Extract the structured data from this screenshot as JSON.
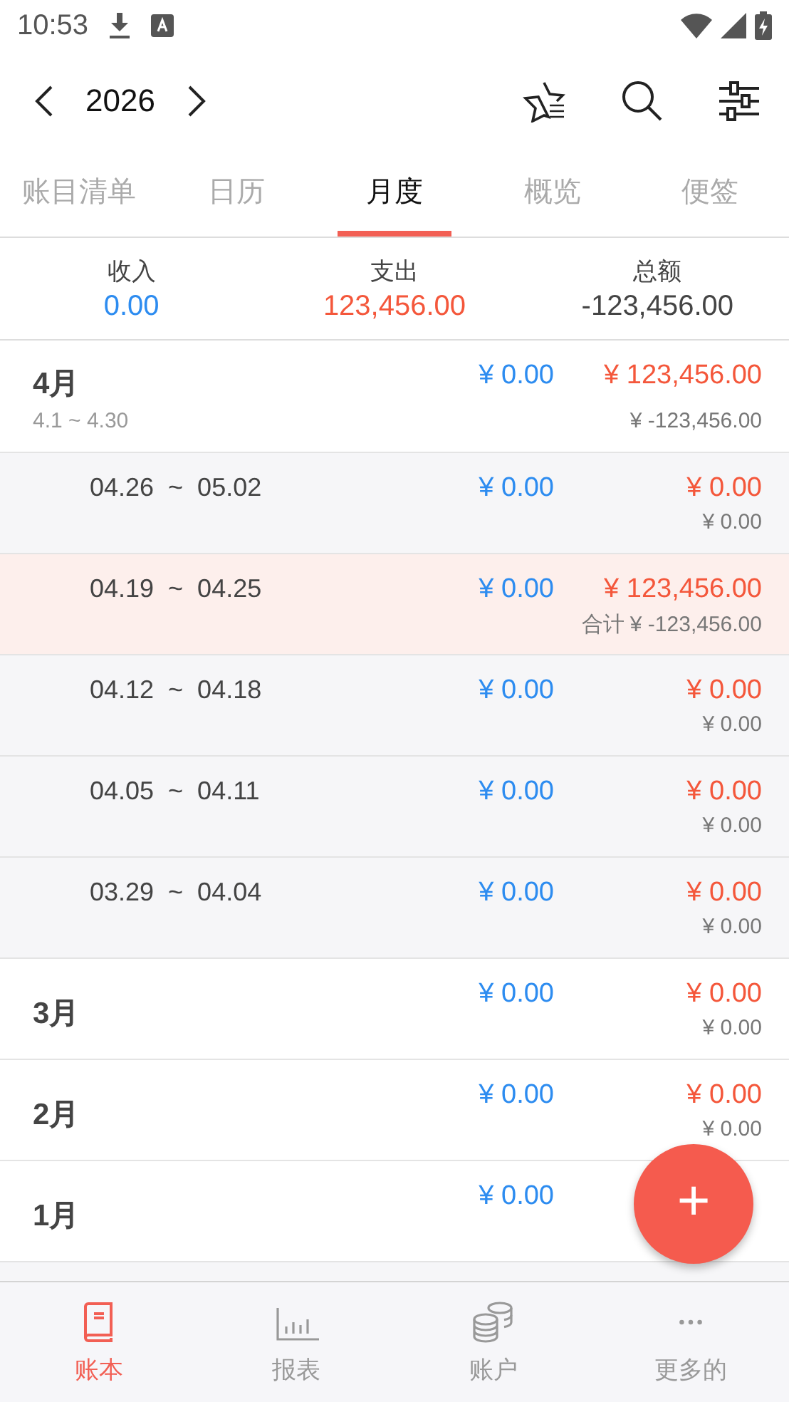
{
  "status_bar": {
    "time": "10:53"
  },
  "toolbar": {
    "year": "2026"
  },
  "tabs": [
    {
      "label": "账目清单",
      "selected": false
    },
    {
      "label": "日历",
      "selected": false
    },
    {
      "label": "月度",
      "selected": true
    },
    {
      "label": "概览",
      "selected": false
    },
    {
      "label": "便签",
      "selected": false
    }
  ],
  "summary": [
    {
      "label": "收入",
      "value": "0.00",
      "kind": "income"
    },
    {
      "label": "支出",
      "value": "123,456.00",
      "kind": "expense"
    },
    {
      "label": "总额",
      "value": "-123,456.00",
      "kind": "total"
    }
  ],
  "rows": [
    {
      "kind": "month",
      "label": "4月",
      "range": "4.1 ~ 4.30",
      "income": "¥ 0.00",
      "expense": "¥ 123,456.00",
      "total": "¥ -123,456.00",
      "selected": false
    },
    {
      "kind": "week",
      "label": "04.26  ~  05.02",
      "income": "¥ 0.00",
      "expense": "¥ 0.00",
      "total": "¥ 0.00",
      "selected": false
    },
    {
      "kind": "week",
      "label": "04.19  ~  04.25",
      "income": "¥ 0.00",
      "expense": "¥ 123,456.00",
      "total": "合计 ¥ -123,456.00",
      "selected": true
    },
    {
      "kind": "week",
      "label": "04.12  ~  04.18",
      "income": "¥ 0.00",
      "expense": "¥ 0.00",
      "total": "¥ 0.00",
      "selected": false
    },
    {
      "kind": "week",
      "label": "04.05  ~  04.11",
      "income": "¥ 0.00",
      "expense": "¥ 0.00",
      "total": "¥ 0.00",
      "selected": false
    },
    {
      "kind": "week",
      "label": "03.29  ~  04.04",
      "income": "¥ 0.00",
      "expense": "¥ 0.00",
      "total": "¥ 0.00",
      "selected": false
    },
    {
      "kind": "month",
      "label": "3月",
      "income": "¥ 0.00",
      "expense": "¥ 0.00",
      "total": "¥ 0.00",
      "selected": false
    },
    {
      "kind": "month",
      "label": "2月",
      "income": "¥ 0.00",
      "expense": "¥ 0.00",
      "total": "¥ 0.00",
      "selected": false
    },
    {
      "kind": "month",
      "label": "1月",
      "income": "¥ 0.00",
      "selected": false
    }
  ],
  "fab": {
    "label": "+"
  },
  "bottom_nav": [
    {
      "label": "账本",
      "kind": "book",
      "selected": true
    },
    {
      "label": "报表",
      "kind": "chart",
      "selected": false
    },
    {
      "label": "账户",
      "kind": "coins",
      "selected": false
    },
    {
      "label": "更多的",
      "kind": "more",
      "selected": false
    }
  ]
}
